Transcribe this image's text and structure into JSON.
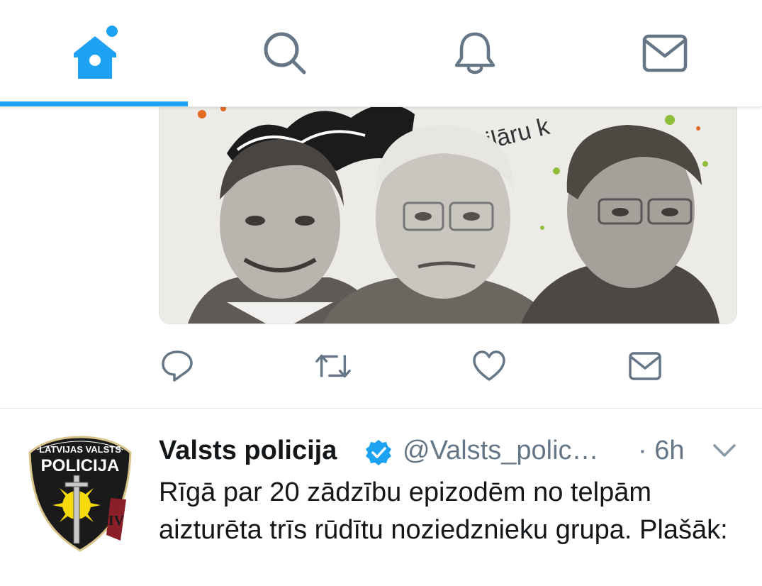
{
  "nav": {
    "tabs": [
      {
        "name": "home",
        "icon": "home-icon",
        "active": true
      },
      {
        "name": "search",
        "icon": "search-icon",
        "active": false
      },
      {
        "name": "notifications",
        "icon": "bell-icon",
        "active": false
      },
      {
        "name": "messages",
        "icon": "mail-icon",
        "active": false
      }
    ]
  },
  "media": {
    "overlay_text": "jubilāru k"
  },
  "tweet_actions": [
    "reply-icon",
    "retweet-icon",
    "like-icon",
    "direct-message-icon"
  ],
  "tweet": {
    "display_name": "Valsts policija",
    "verified": true,
    "handle": "@Valsts_polic…",
    "time": "· 6h",
    "text": "Rīgā par 20 zādzību epizodēm no telpām aizturēta trīs rūdītu noziedznieku grupa. Plašāk:",
    "avatar": {
      "ring_text": "LATVIJAS VALSTS",
      "banner_text": "POLICIJA",
      "roman": "IV"
    }
  },
  "colors": {
    "accent": "#1da1f2",
    "icon_gray": "#657786",
    "text": "#14171a",
    "divider": "#e1e8ed"
  }
}
